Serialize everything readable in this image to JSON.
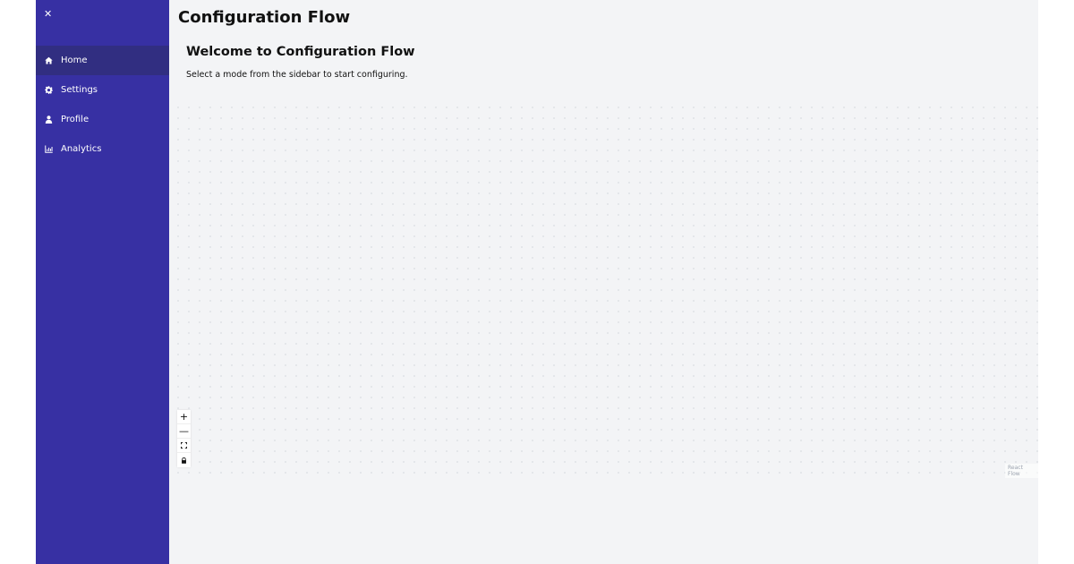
{
  "sidebar": {
    "close_icon": "✕",
    "items": [
      {
        "label": "Home",
        "icon": "home-icon",
        "active": true
      },
      {
        "label": "Settings",
        "icon": "gear-icon",
        "active": false
      },
      {
        "label": "Profile",
        "icon": "user-icon",
        "active": false
      },
      {
        "label": "Analytics",
        "icon": "chart-icon",
        "active": false
      }
    ],
    "color": "#3730a3",
    "active_color": "#312e81"
  },
  "header": {
    "title": "Configuration Flow"
  },
  "main": {
    "welcome_title": "Welcome to Configuration Flow",
    "welcome_text": "Select a mode from the sidebar to start configuring.",
    "background_color": "#f3f4f6"
  },
  "flow": {
    "controls": [
      {
        "name": "zoom-in",
        "glyph": "+"
      },
      {
        "name": "zoom-out",
        "glyph": "—"
      },
      {
        "name": "fit-view",
        "icon": "fit-view-icon"
      },
      {
        "name": "lock",
        "icon": "lock-icon"
      }
    ],
    "attribution": "React Flow"
  }
}
